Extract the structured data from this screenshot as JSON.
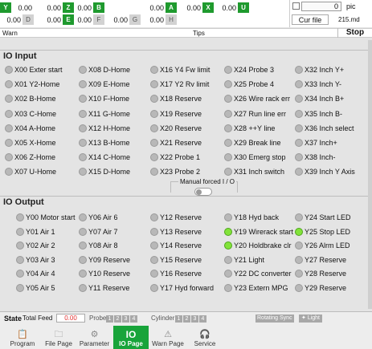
{
  "axes": [
    {
      "label": "Y",
      "val": "0.00",
      "lit": true
    },
    {
      "label": "Z",
      "val": "0.00",
      "lit": true
    },
    {
      "label": "B",
      "val": "0.00",
      "lit": true
    },
    {
      "label": "A",
      "val": "0.00",
      "lit": true
    },
    {
      "label": "X",
      "val": "0.00",
      "lit": true
    },
    {
      "label": "U",
      "val": "0.00",
      "lit": true
    },
    {
      "label": "D",
      "val": "0.00",
      "lit": false
    },
    {
      "label": "E",
      "val": "0.00",
      "lit": true
    },
    {
      "label": "F",
      "val": "0.00",
      "lit": false
    },
    {
      "label": "G",
      "val": "0.00",
      "lit": false
    },
    {
      "label": "H",
      "val": "0.00",
      "lit": false
    }
  ],
  "counter": {
    "value": "0",
    "unit": "pic",
    "cur_file_label": "Cur file",
    "file_name": "215.md"
  },
  "status_bar": {
    "warn": "Warn",
    "tips": "Tips",
    "stop": "Stop"
  },
  "io_input": {
    "title": "IO Input",
    "items": [
      "X00 Exter start",
      "X01 Y2-Home",
      "X02 B-Home",
      "X03 C-Home",
      "X04 A-Home",
      "X05 X-Home",
      "X06 Z-Home",
      "X07 U-Home",
      "X08 D-Home",
      "X09 E-Home",
      "X10 F-Home",
      "X11 G-Home",
      "X12 H-Home",
      "X13 B-Home",
      "X14 C-Home",
      "X15 D-Home",
      "X16 Y4 Fw limit",
      "X17 Y2 Rv limit",
      "X18 Reserve",
      "X19 Reserve",
      "X20 Reserve",
      "X21 Reserve",
      "X22 Probe 1",
      "X23 Probe 2",
      "X24 Probe 3",
      "X25 Probe 4",
      "X26 Wire rack err",
      "X27 Run line err",
      "X28 ++Y line",
      "X29 Break line",
      "X30 Emerg stop",
      "X31 Inch switch",
      "X32 Inch Y+",
      "X33 Inch Y-",
      "X34 Inch B+",
      "X35 Inch B-",
      "X36 Inch select",
      "X37 Inch+",
      "X38 Inch-",
      "X39 Inch Y Axis"
    ]
  },
  "manual_forced_label": "Manual forced I / O",
  "io_output": {
    "title": "IO Output",
    "items": [
      {
        "t": "Y00 Motor start",
        "on": false
      },
      {
        "t": "Y01 Air 1",
        "on": false
      },
      {
        "t": "Y02 Air 2",
        "on": false
      },
      {
        "t": "Y03 Air 3",
        "on": false
      },
      {
        "t": "Y04 Air 4",
        "on": false
      },
      {
        "t": "Y05 Air 5",
        "on": false
      },
      {
        "t": "Y06 Air 6",
        "on": false
      },
      {
        "t": "Y07 Air 7",
        "on": false
      },
      {
        "t": "Y08 Air 8",
        "on": false
      },
      {
        "t": "Y09 Reserve",
        "on": false
      },
      {
        "t": "Y10 Reserve",
        "on": false
      },
      {
        "t": "Y11 Reserve",
        "on": false
      },
      {
        "t": "Y12 Reserve",
        "on": false
      },
      {
        "t": "Y13 Reserve",
        "on": false
      },
      {
        "t": "Y14 Reserve",
        "on": false
      },
      {
        "t": "Y15 Reserve",
        "on": false
      },
      {
        "t": "Y16 Reserve",
        "on": false
      },
      {
        "t": "Y17 Hyd forward",
        "on": false
      },
      {
        "t": "Y18 Hyd back",
        "on": false
      },
      {
        "t": "Y19 Wirerack start",
        "on": true
      },
      {
        "t": "Y20 Holdbrake clr",
        "on": true
      },
      {
        "t": "Y21 Light",
        "on": false
      },
      {
        "t": "Y22 DC converter",
        "on": false
      },
      {
        "t": "Y23 Extern MPG",
        "on": false
      },
      {
        "t": "Y24 Start LED",
        "on": false
      },
      {
        "t": "Y25 Stop LED",
        "on": true
      },
      {
        "t": "Y26 Alrm LED",
        "on": false
      },
      {
        "t": "Y27 Reserve",
        "on": false
      },
      {
        "t": "Y28 Reserve",
        "on": false
      },
      {
        "t": "Y29 Reserve",
        "on": false
      }
    ]
  },
  "state_bar": {
    "state": "State",
    "total_feed_label": "Total Feed",
    "total_feed_value": "0.00",
    "probe_label": "Probe",
    "probes": [
      "1",
      "2",
      "3",
      "4"
    ],
    "cylinder_label": "Cylinder",
    "cylinders": [
      "1",
      "2",
      "3",
      "4"
    ],
    "rotating_sync": "Rotating Sync",
    "light": "Light"
  },
  "tabs": [
    {
      "label": "Program",
      "icon": "clipboard-icon",
      "active": false
    },
    {
      "label": "File Page",
      "icon": "folder-icon",
      "active": false
    },
    {
      "label": "Parameter",
      "icon": "gear-icon",
      "active": false
    },
    {
      "label": "IO Page",
      "icon": "io-icon",
      "active": true
    },
    {
      "label": "Warn Page",
      "icon": "warning-icon",
      "active": false
    },
    {
      "label": "Service",
      "icon": "headset-icon",
      "active": false
    }
  ],
  "colors": {
    "accent": "#18a43a",
    "led_on": "#82e33a",
    "led_off": "#b8b8b8"
  }
}
